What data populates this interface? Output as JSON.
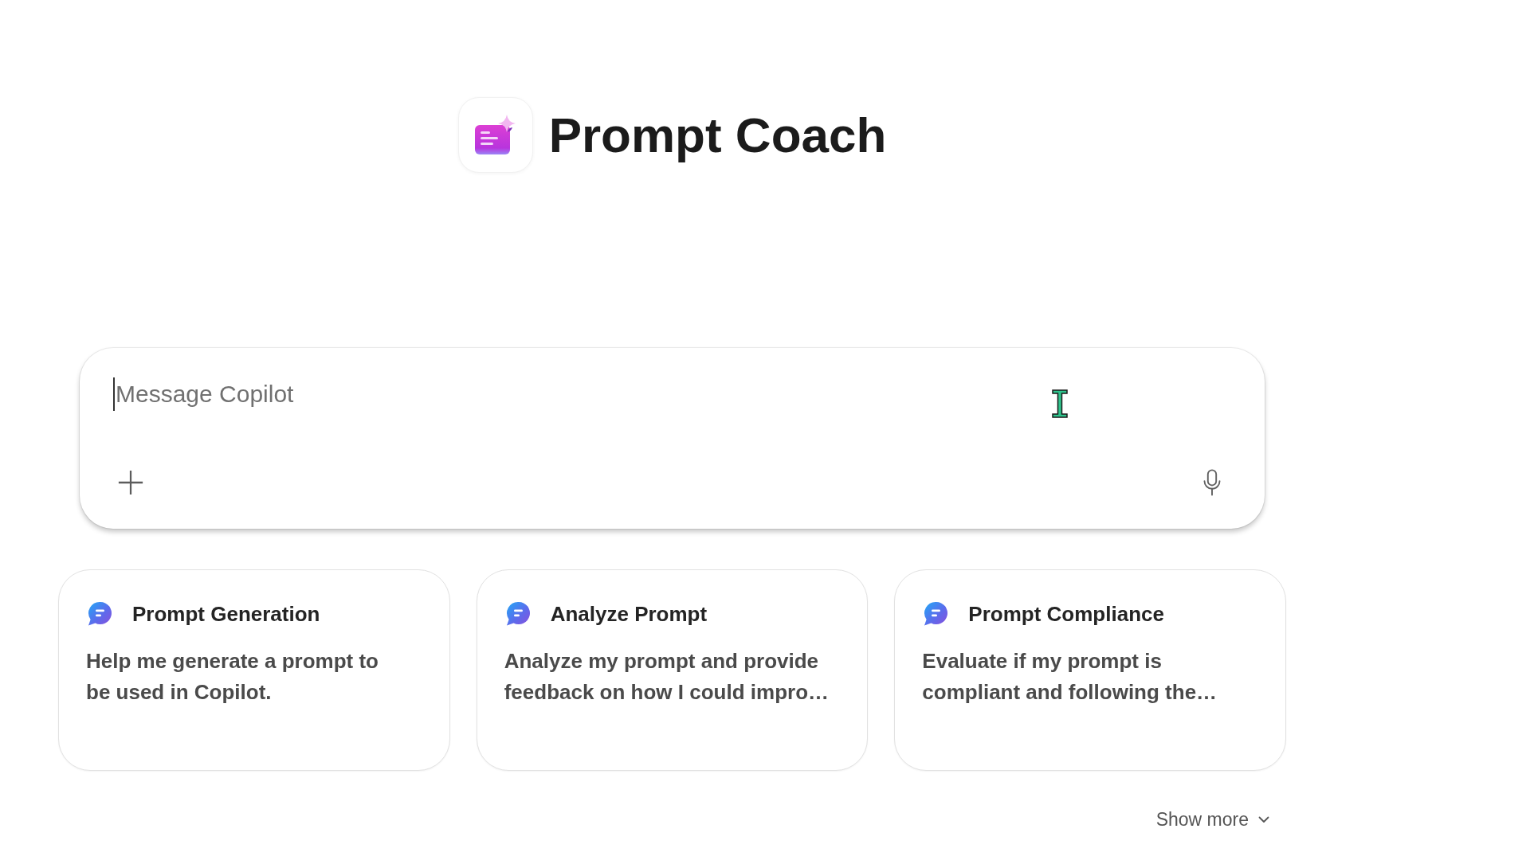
{
  "agent": {
    "name": "Prompt Coach"
  },
  "composer": {
    "placeholder": "Message Copilot",
    "focused": true
  },
  "suggestions": [
    {
      "title": "Prompt Generation",
      "description": "Help me generate a prompt to\nbe used in Copilot."
    },
    {
      "title": "Analyze Prompt",
      "description": "Analyze my prompt and provide\nfeedback on how I could impro…"
    },
    {
      "title": "Prompt Compliance",
      "description": "Evaluate if my prompt is\ncompliant and following the…"
    }
  ],
  "show_more": {
    "label": "Show more"
  }
}
